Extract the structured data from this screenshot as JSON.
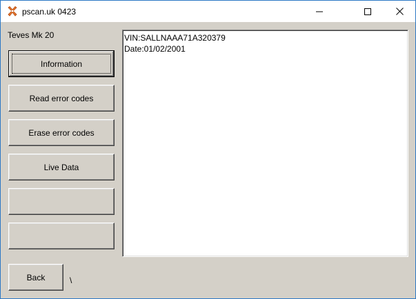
{
  "window": {
    "title": "pscan.uk 0423",
    "icon": "pscan-app-icon"
  },
  "caption_buttons": {
    "minimize_icon": "minimize-icon",
    "maximize_icon": "maximize-icon",
    "close_icon": "close-icon"
  },
  "module_label": "Teves Mk 20",
  "buttons": {
    "information": "Information",
    "read_error_codes": "Read error codes",
    "erase_error_codes": "Erase error codes",
    "live_data": "Live Data",
    "empty1": "",
    "empty2": "",
    "back": "Back"
  },
  "status_text": "\\",
  "output": {
    "lines": [
      "VIN:SALLNAAA71A320379",
      "Date:01/02/2001"
    ]
  }
}
